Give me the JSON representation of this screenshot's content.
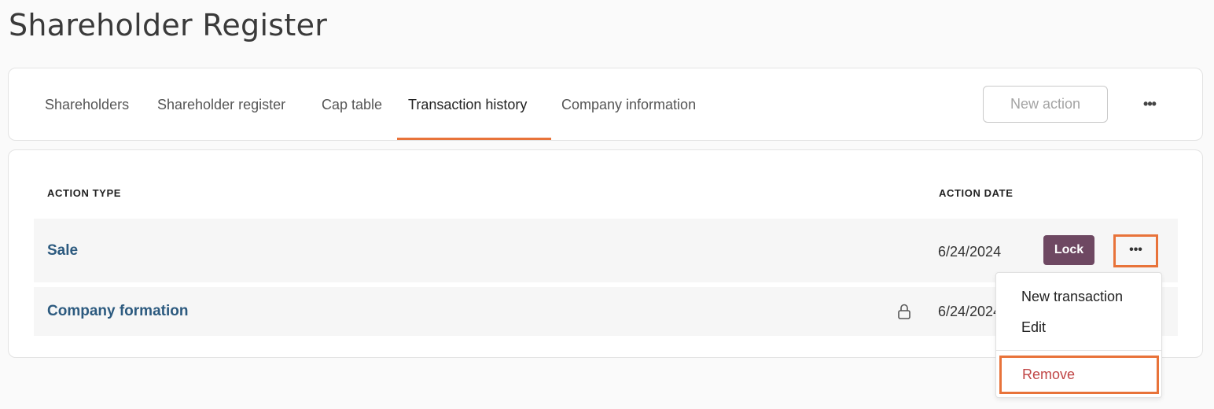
{
  "page": {
    "title": "Shareholder Register"
  },
  "tabs": [
    {
      "label": "Shareholders"
    },
    {
      "label": "Shareholder register"
    },
    {
      "label": "Cap table"
    },
    {
      "label": "Transaction history",
      "active": true
    },
    {
      "label": "Company information"
    }
  ],
  "toolbar": {
    "new_action_label": "New action",
    "more_label": "•••"
  },
  "table": {
    "headers": {
      "action_type": "ACTION TYPE",
      "action_date": "ACTION DATE"
    },
    "rows": [
      {
        "name": "Sale",
        "date": "6/24/2024",
        "lock_label": "Lock",
        "more_label": "•••",
        "locked": false
      },
      {
        "name": "Company formation",
        "date": "6/24/2024",
        "locked": true
      }
    ]
  },
  "menu": {
    "items": [
      {
        "label": "New transaction"
      },
      {
        "label": "Edit"
      }
    ],
    "remove_label": "Remove"
  },
  "colors": {
    "accent": "#e8733a",
    "link": "#2c5a7f",
    "lock_button": "#6e4862",
    "danger": "#c04545"
  },
  "icons": {
    "row_lock": "lock-icon"
  }
}
